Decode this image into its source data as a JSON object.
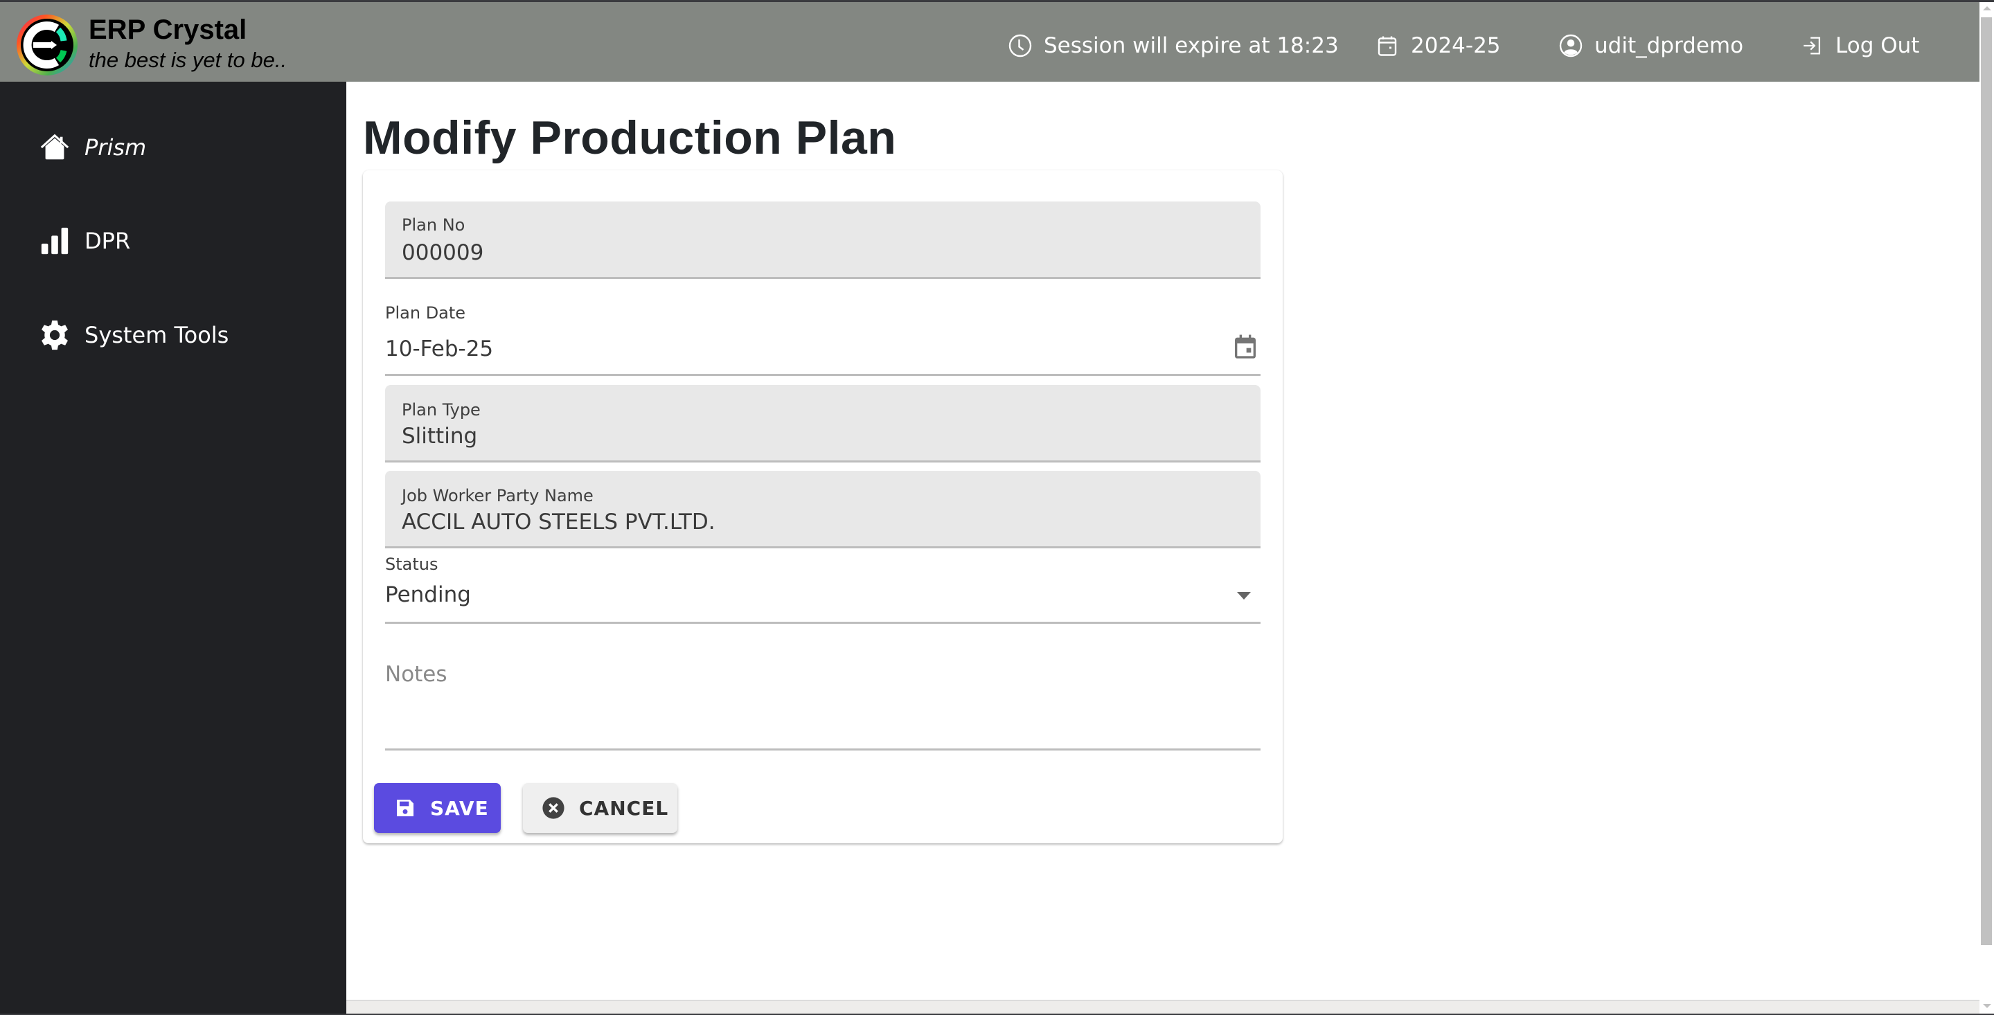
{
  "header": {
    "brand_title": "ERP Crystal",
    "brand_tagline": "the best is yet to be..",
    "session_text": "Session will expire at 18:23",
    "financial_year": "2024-25",
    "username": "udit_dprdemo",
    "logout_label": "Log Out"
  },
  "sidebar": {
    "items": [
      {
        "label": "Prism",
        "icon": "home-icon"
      },
      {
        "label": "DPR",
        "icon": "bar-chart-icon"
      },
      {
        "label": "System Tools",
        "icon": "gear-icon"
      }
    ]
  },
  "page": {
    "title": "Modify Production Plan"
  },
  "form": {
    "plan_no": {
      "label": "Plan No",
      "value": "000009"
    },
    "plan_date": {
      "label": "Plan Date",
      "value": "10-Feb-25"
    },
    "plan_type": {
      "label": "Plan Type",
      "value": "Slitting"
    },
    "job_worker": {
      "label": "Job Worker Party Name",
      "value": "ACCIL AUTO STEELS PVT.LTD."
    },
    "status": {
      "label": "Status",
      "value": "Pending"
    },
    "notes": {
      "placeholder": "Notes",
      "value": ""
    }
  },
  "actions": {
    "save_label": "SAVE",
    "cancel_label": "CANCEL"
  },
  "colors": {
    "header_bg": "#838782",
    "sidebar_bg": "#202124",
    "save_button": "#5b4be0",
    "cancel_button": "#efefef"
  }
}
